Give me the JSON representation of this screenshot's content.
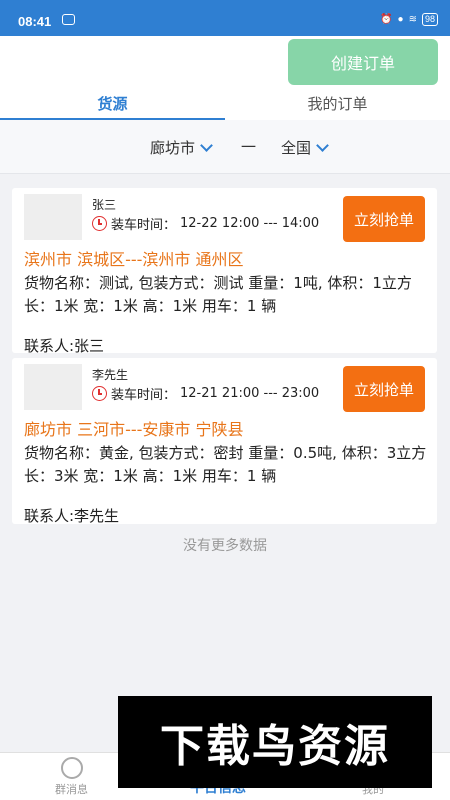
{
  "status_bar": {
    "time": "08:41",
    "battery": "98"
  },
  "topbar": {
    "create_order_label": "创建订单"
  },
  "tabs": [
    {
      "label": "货源"
    },
    {
      "label": "我的订单"
    }
  ],
  "filters": {
    "origin": "廊坊市",
    "separator": "一",
    "destination": "全国"
  },
  "orders": [
    {
      "contact_name": "张三",
      "load_time_label": "装车时间：",
      "load_time": "12-22 12:00 --- 14:00",
      "grab_label": "立刻抢单",
      "route": "滨州市 滨城区---滨州市 通州区",
      "description": "货物名称：测试, 包装方式：测试 重量：1吨, 体积：1立方 长：1米 宽：1米 高：1米 用车：1 辆",
      "contact": "联系人:张三"
    },
    {
      "contact_name": "李先生",
      "load_time_label": "装车时间：",
      "load_time": "12-21 21:00 --- 23:00",
      "grab_label": "立刻抢单",
      "route": "廊坊市 三河市---安康市 宁陕县",
      "description": "货物名称：黄金, 包装方式：密封 重量：0.5吨, 体积：3立方 长：3米 宽：1米 高：1米 用车：1 辆",
      "contact": "联系人:李先生"
    }
  ],
  "no_more_text": "没有更多数据",
  "bottom_nav": [
    {
      "label": "群消息"
    },
    {
      "label": "平台信息"
    },
    {
      "label": "我的"
    }
  ],
  "watermark_text": "下载鸟资源",
  "colors": {
    "primary": "#2f7fd2",
    "accent": "#f36f12",
    "route": "#e8751a",
    "create_button": "#87d5a8"
  }
}
